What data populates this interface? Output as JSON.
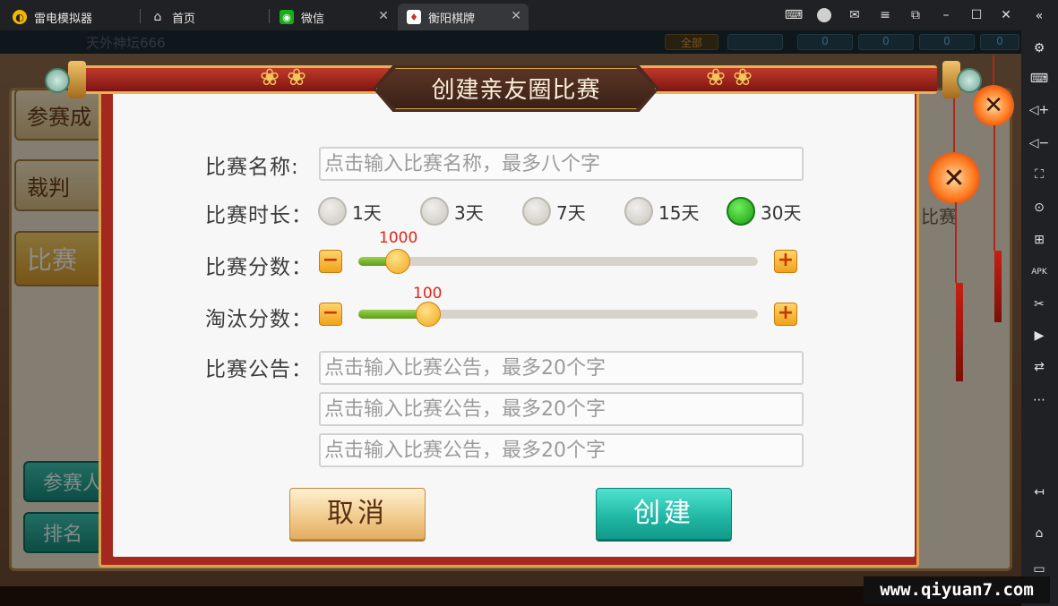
{
  "window": {
    "app_name": "雷电模拟器",
    "tabs": [
      {
        "label": "首页"
      },
      {
        "label": "微信"
      },
      {
        "label": "衡阳棋牌"
      }
    ]
  },
  "game_background": {
    "player_name": "天外神坛666",
    "left_menu": [
      "参赛成",
      "裁判",
      "比赛"
    ],
    "left_bottom": [
      "参赛人",
      "排名"
    ],
    "right_fragment": "比赛",
    "header_values": [
      "全部",
      "0",
      "0",
      "0",
      "0"
    ]
  },
  "dialog": {
    "title": "创建亲友圈比赛",
    "name_label": "比赛名称:",
    "name_placeholder": "点击输入比赛名称，最多八个字",
    "duration_label": "比赛时长：",
    "duration_options": [
      {
        "label": "1天",
        "selected": false
      },
      {
        "label": "3天",
        "selected": false
      },
      {
        "label": "7天",
        "selected": false
      },
      {
        "label": "15天",
        "selected": false
      },
      {
        "label": "30天",
        "selected": true
      }
    ],
    "score_label": "比赛分数：",
    "score_value": "1000",
    "elim_label": "淘汰分数：",
    "elim_value": "100",
    "notice_label": "比赛公告：",
    "notice_placeholders": [
      "点击输入比赛公告，最多20个字",
      "点击输入比赛公告，最多20个字",
      "点击输入比赛公告，最多20个字"
    ],
    "minus_glyph": "−",
    "plus_glyph": "+",
    "cancel_label": "取消",
    "create_label": "创建"
  },
  "close_glyph": "✕",
  "watermark": "www.qiyuan7.com",
  "icons": {
    "topbar": [
      "gamepad-icon",
      "user-icon",
      "mail-icon",
      "menu-icon",
      "resize-icon",
      "minimize-icon",
      "maximize-icon",
      "close-icon"
    ],
    "sidebar": [
      "collapse-icon",
      "settings-icon",
      "keyboard-icon",
      "volume-up-icon",
      "volume-down-icon",
      "screenshot-icon",
      "record-icon",
      "add-app-icon",
      "apk-icon",
      "scissors-icon",
      "video-icon",
      "sync-icon",
      "more-icon",
      "back-icon",
      "home-icon",
      "recent-apps-icon"
    ]
  }
}
